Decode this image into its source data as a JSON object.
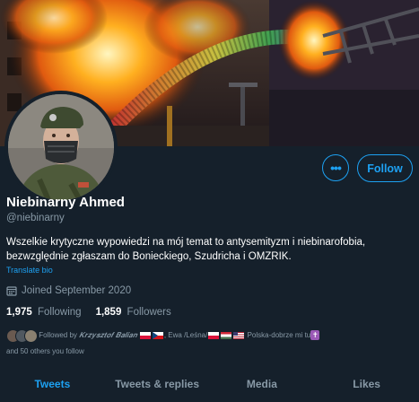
{
  "profile": {
    "name": "Niebinarny Ahmed",
    "handle": "@niebinarny",
    "bio": "Wszelkie krytyczne wypowiedzi na mój temat to antysemityzm i niebinarofobia, bezwzględnie zgłaszam do Bonieckiego, Szudricha i OMZRIK.",
    "translate_label": "Translate bio",
    "joined": "Joined September 2020"
  },
  "actions": {
    "more_label": "•••",
    "follow_label": "Follow"
  },
  "stats": {
    "following_count": "1,975",
    "following_label": "Following",
    "followers_count": "1,859",
    "followers_label": "Followers"
  },
  "followed_by": {
    "prefix": "Followed by",
    "name1": "𝑲𝒓𝒛𝒚𝒔𝒛𝒕𝒐𝒇 𝑩𝒂𝒍𝒊𝒂𝒏",
    "name2": "Ewa /Leśna/",
    "name3": "Polska-dobrze mi tu",
    "others": "and 50 others you follow"
  },
  "tabs": [
    {
      "label": "Tweets",
      "active": true
    },
    {
      "label": "Tweets & replies",
      "active": false
    },
    {
      "label": "Media",
      "active": false
    },
    {
      "label": "Likes",
      "active": false
    }
  ],
  "colors": {
    "background": "#15202b",
    "accent": "#1da1f2",
    "muted": "#8899a6"
  },
  "icons": [
    "calendar-icon",
    "more-icon",
    "flag-poland-icon",
    "flag-czech-icon",
    "flag-hungary-icon",
    "flag-usa-icon",
    "cross-icon"
  ]
}
